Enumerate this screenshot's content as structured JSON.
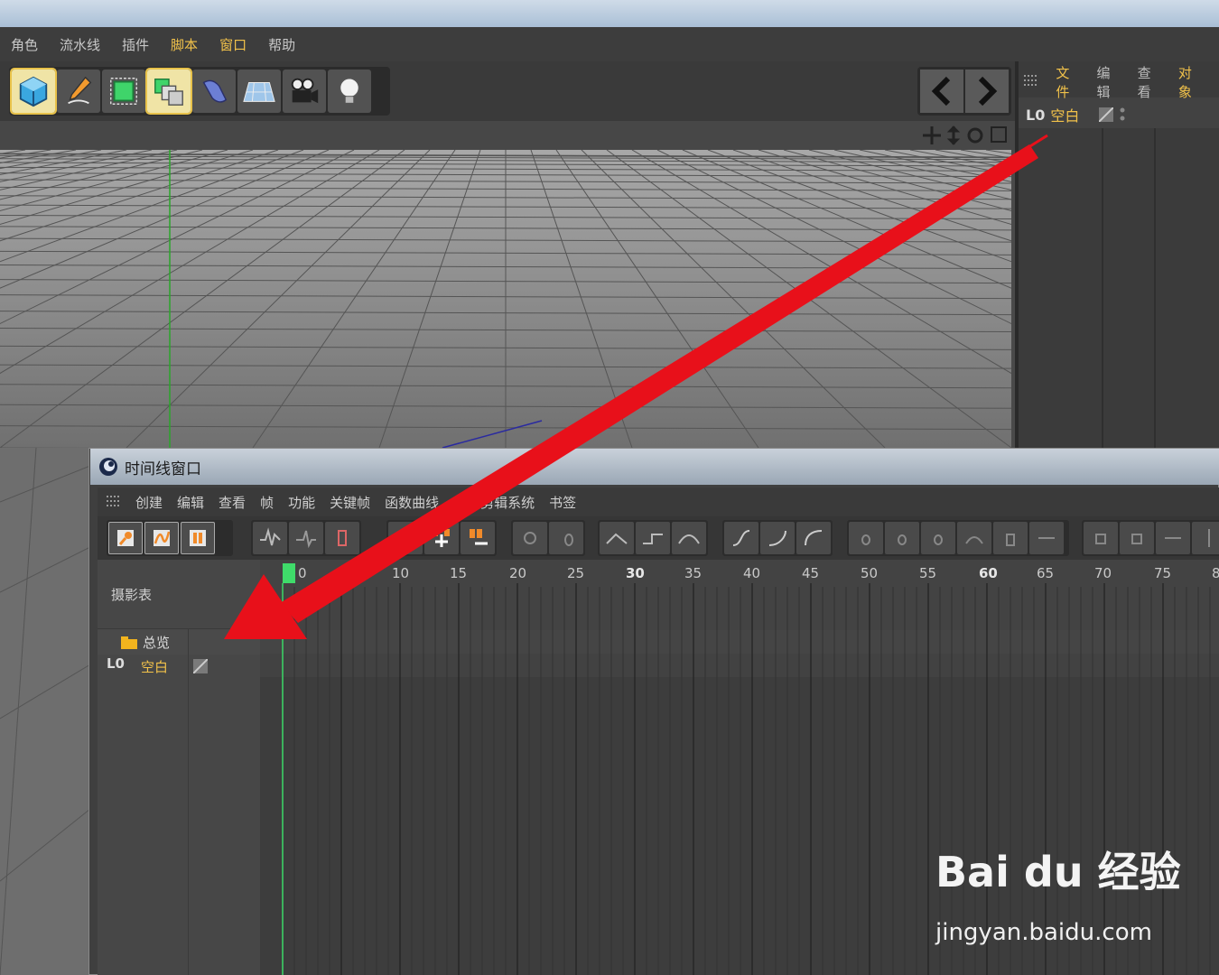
{
  "main_menu": {
    "items": [
      {
        "label": "角色",
        "highlight": false
      },
      {
        "label": "流水线",
        "highlight": false
      },
      {
        "label": "插件",
        "highlight": false
      },
      {
        "label": "脚本",
        "highlight": true
      },
      {
        "label": "窗口",
        "highlight": true
      },
      {
        "label": "帮助",
        "highlight": false
      }
    ]
  },
  "object_manager": {
    "menu": [
      {
        "label": "文件"
      },
      {
        "label": "编辑"
      },
      {
        "label": "查看"
      },
      {
        "label": "对象"
      }
    ],
    "object": {
      "icon": "L0",
      "name": "空白"
    }
  },
  "timeline": {
    "title": "时间线窗口",
    "menu": [
      "创建",
      "编辑",
      "查看",
      "帧",
      "功能",
      "关键帧",
      "函数曲线",
      "运动剪辑系统",
      "书签"
    ],
    "section_label": "摄影表",
    "tree": {
      "summary": "总览",
      "object_icon": "L0",
      "object_name": "空白"
    },
    "ruler_ticks": [
      "0",
      "10",
      "15",
      "20",
      "25",
      "30",
      "35",
      "40",
      "45",
      "50",
      "55",
      "60",
      "65",
      "70",
      "75",
      "8"
    ],
    "current_frame": 0
  },
  "watermark": {
    "brand": "Bai du 经验",
    "url": "jingyan.baidu.com"
  },
  "colors": {
    "accent": "#f2c24a",
    "playhead": "#3fdc6a",
    "arrow": "#e8101a"
  }
}
